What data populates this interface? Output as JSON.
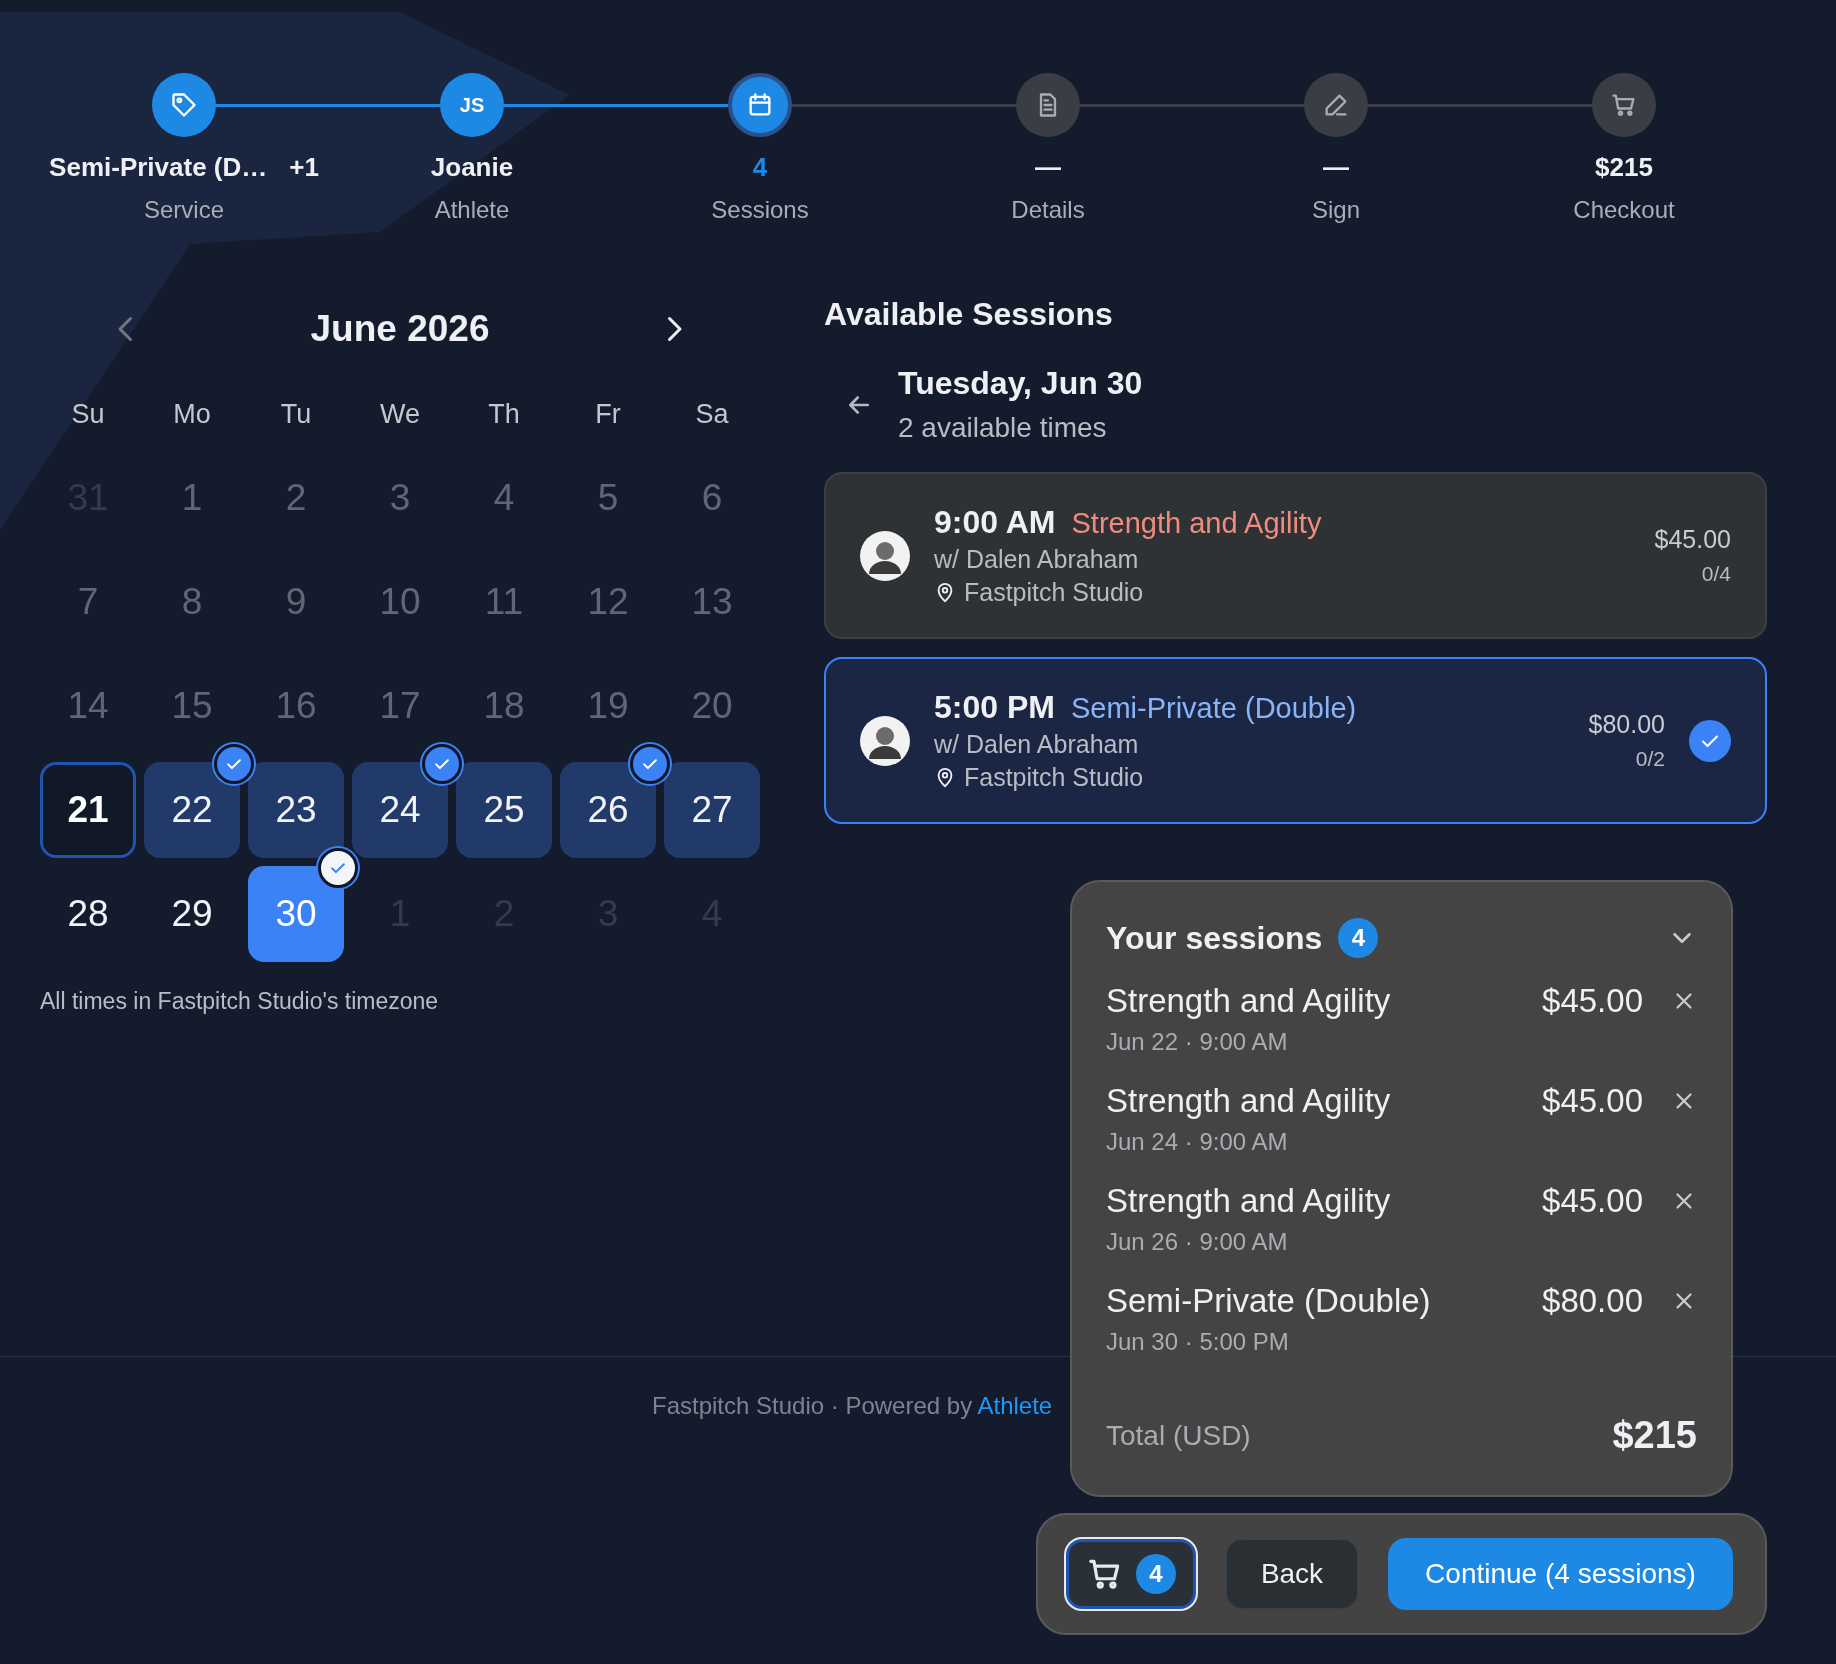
{
  "steps": [
    {
      "value": "Semi-Private (D…",
      "extra": "+1",
      "label": "Service",
      "kind": "done"
    },
    {
      "initials": "JS",
      "value": "Joanie",
      "label": "Athlete",
      "kind": "done"
    },
    {
      "value": "4",
      "label": "Sessions",
      "kind": "current"
    },
    {
      "value": "—",
      "label": "Details",
      "kind": "pending"
    },
    {
      "value": "—",
      "label": "Sign",
      "kind": "pending"
    },
    {
      "value": "$215",
      "label": "Checkout",
      "kind": "pending"
    }
  ],
  "calendar": {
    "month": "June 2026",
    "weekdays": [
      "Su",
      "Mo",
      "Tu",
      "We",
      "Th",
      "Fr",
      "Sa"
    ],
    "days": [
      {
        "label": "31",
        "kind": "outside",
        "selected": false,
        "booked": false
      },
      {
        "label": "1",
        "kind": "past",
        "selected": false,
        "booked": false
      },
      {
        "label": "2",
        "kind": "past",
        "selected": false,
        "booked": false
      },
      {
        "label": "3",
        "kind": "past",
        "selected": false,
        "booked": false
      },
      {
        "label": "4",
        "kind": "past",
        "selected": false,
        "booked": false
      },
      {
        "label": "5",
        "kind": "past",
        "selected": false,
        "booked": false
      },
      {
        "label": "6",
        "kind": "past",
        "selected": false,
        "booked": false
      },
      {
        "label": "7",
        "kind": "past",
        "selected": false,
        "booked": false
      },
      {
        "label": "8",
        "kind": "past",
        "selected": false,
        "booked": false
      },
      {
        "label": "9",
        "kind": "past",
        "selected": false,
        "booked": false
      },
      {
        "label": "10",
        "kind": "past",
        "selected": false,
        "booked": false
      },
      {
        "label": "11",
        "kind": "past",
        "selected": false,
        "booked": false
      },
      {
        "label": "12",
        "kind": "past",
        "selected": false,
        "booked": false
      },
      {
        "label": "13",
        "kind": "past",
        "selected": false,
        "booked": false
      },
      {
        "label": "14",
        "kind": "past",
        "selected": false,
        "booked": false
      },
      {
        "label": "15",
        "kind": "past",
        "selected": false,
        "booked": false
      },
      {
        "label": "16",
        "kind": "past",
        "selected": false,
        "booked": false
      },
      {
        "label": "17",
        "kind": "past",
        "selected": false,
        "booked": false
      },
      {
        "label": "18",
        "kind": "past",
        "selected": false,
        "booked": false
      },
      {
        "label": "19",
        "kind": "past",
        "selected": false,
        "booked": false
      },
      {
        "label": "20",
        "kind": "past",
        "selected": false,
        "booked": false
      },
      {
        "label": "21",
        "kind": "today",
        "selected": false,
        "booked": false
      },
      {
        "label": "22",
        "kind": "available",
        "selected": false,
        "booked": true
      },
      {
        "label": "23",
        "kind": "available",
        "selected": false,
        "booked": false
      },
      {
        "label": "24",
        "kind": "available",
        "selected": false,
        "booked": true
      },
      {
        "label": "25",
        "kind": "available",
        "selected": false,
        "booked": false
      },
      {
        "label": "26",
        "kind": "available",
        "selected": false,
        "booked": true
      },
      {
        "label": "27",
        "kind": "available",
        "selected": false,
        "booked": false
      },
      {
        "label": "28",
        "kind": "open",
        "selected": false,
        "booked": false
      },
      {
        "label": "29",
        "kind": "open",
        "selected": false,
        "booked": false
      },
      {
        "label": "30",
        "kind": "available",
        "selected": true,
        "booked": true
      },
      {
        "label": "1",
        "kind": "outside",
        "selected": false,
        "booked": false
      },
      {
        "label": "2",
        "kind": "outside",
        "selected": false,
        "booked": false
      },
      {
        "label": "3",
        "kind": "outside",
        "selected": false,
        "booked": false
      },
      {
        "label": "4",
        "kind": "outside",
        "selected": false,
        "booked": false
      }
    ],
    "note": "All times in Fastpitch Studio's timezone"
  },
  "available": {
    "title": "Available Sessions",
    "date": "Tuesday, Jun 30",
    "count": "2 available times",
    "sessions": [
      {
        "time": "9:00 AM",
        "name": "Strength and Agility",
        "color": "#f28b7d",
        "coach": "w/ Dalen Abraham",
        "location": "Fastpitch Studio",
        "price": "$45.00",
        "spots": "0/4",
        "selected": false
      },
      {
        "time": "5:00 PM",
        "name": "Semi-Private (Double)",
        "color": "#8ab4f8",
        "coach": "w/ Dalen Abraham",
        "location": "Fastpitch Studio",
        "price": "$80.00",
        "spots": "0/2",
        "selected": true
      }
    ]
  },
  "footer": {
    "text": "Fastpitch Studio · Powered by ",
    "link": "Athlete"
  },
  "summary": {
    "title": "Your sessions",
    "count": "4",
    "items": [
      {
        "name": "Strength and Agility",
        "price": "$45.00",
        "detail": "Jun 22 · 9:00 AM"
      },
      {
        "name": "Strength and Agility",
        "price": "$45.00",
        "detail": "Jun 24 · 9:00 AM"
      },
      {
        "name": "Strength and Agility",
        "price": "$45.00",
        "detail": "Jun 26 · 9:00 AM"
      },
      {
        "name": "Semi-Private (Double)",
        "price": "$80.00",
        "detail": "Jun 30 · 5:00 PM"
      }
    ],
    "total_label": "Total (USD)",
    "total": "$215"
  },
  "actions": {
    "cart_count": "4",
    "back": "Back",
    "continue": "Continue (4 sessions)"
  }
}
